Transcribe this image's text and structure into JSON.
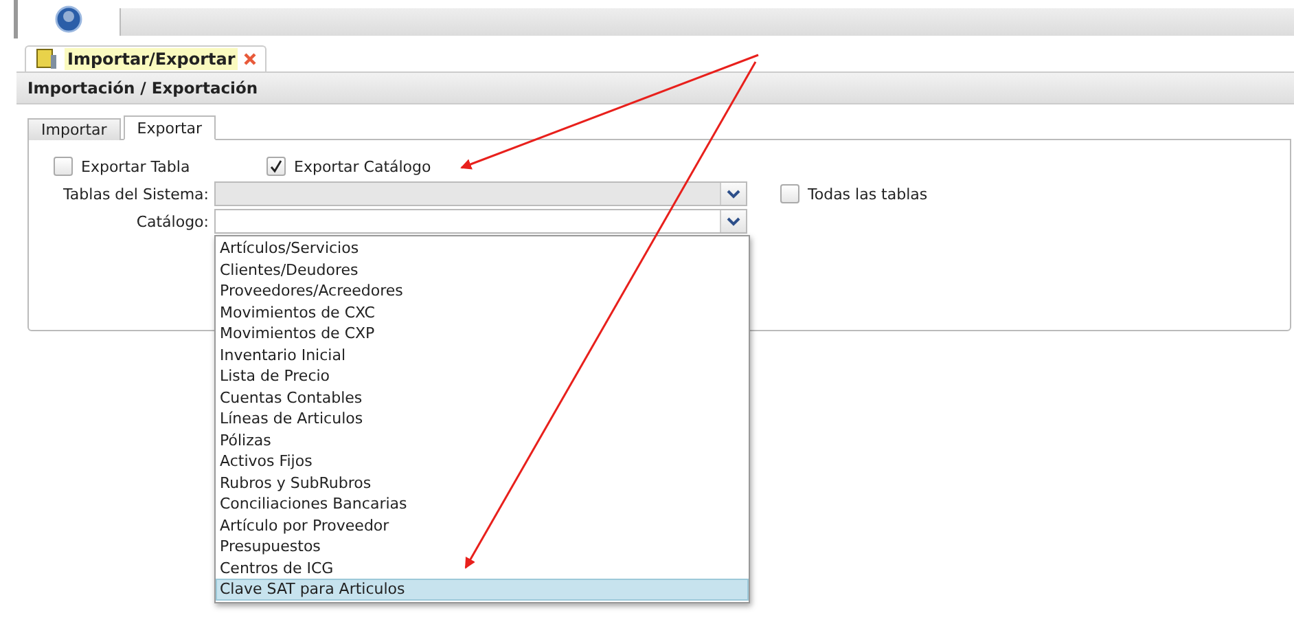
{
  "app_tab": {
    "label": "Importar/Exportar",
    "closable": true
  },
  "panel_title": "Importación / Exportación",
  "sub_tabs": [
    {
      "label": "Importar",
      "selected": false
    },
    {
      "label": "Exportar",
      "selected": true
    }
  ],
  "export_options": [
    {
      "label": "Exportar Tabla",
      "checked": false
    },
    {
      "label": "Exportar Catálogo",
      "checked": true
    }
  ],
  "fields": [
    {
      "label": "Tablas del Sistema:",
      "disabled": true
    },
    {
      "label": "Catálogo:",
      "disabled": false
    }
  ],
  "all_tables": {
    "label": "Todas las tablas",
    "checked": false
  },
  "dropdown": {
    "items": [
      {
        "label": "Artículos/Servicios",
        "selected": false
      },
      {
        "label": "Clientes/Deudores",
        "selected": false
      },
      {
        "label": "Proveedores/Acreedores",
        "selected": false
      },
      {
        "label": "Movimientos de CXC",
        "selected": false
      },
      {
        "label": "Movimientos de CXP",
        "selected": false
      },
      {
        "label": "Inventario Inicial",
        "selected": false
      },
      {
        "label": "Lista de Precio",
        "selected": false
      },
      {
        "label": "Cuentas Contables",
        "selected": false
      },
      {
        "label": "Líneas de Articulos",
        "selected": false
      },
      {
        "label": "Pólizas",
        "selected": false
      },
      {
        "label": "Activos Fijos",
        "selected": false
      },
      {
        "label": "Rubros y SubRubros",
        "selected": false
      },
      {
        "label": "Conciliaciones Bancarias",
        "selected": false
      },
      {
        "label": "Artículo por Proveedor",
        "selected": false
      },
      {
        "label": "Presupuestos",
        "selected": false
      },
      {
        "label": "Centros de ICG",
        "selected": false
      },
      {
        "label": "Clave SAT para Articulos",
        "selected": true
      }
    ]
  }
}
